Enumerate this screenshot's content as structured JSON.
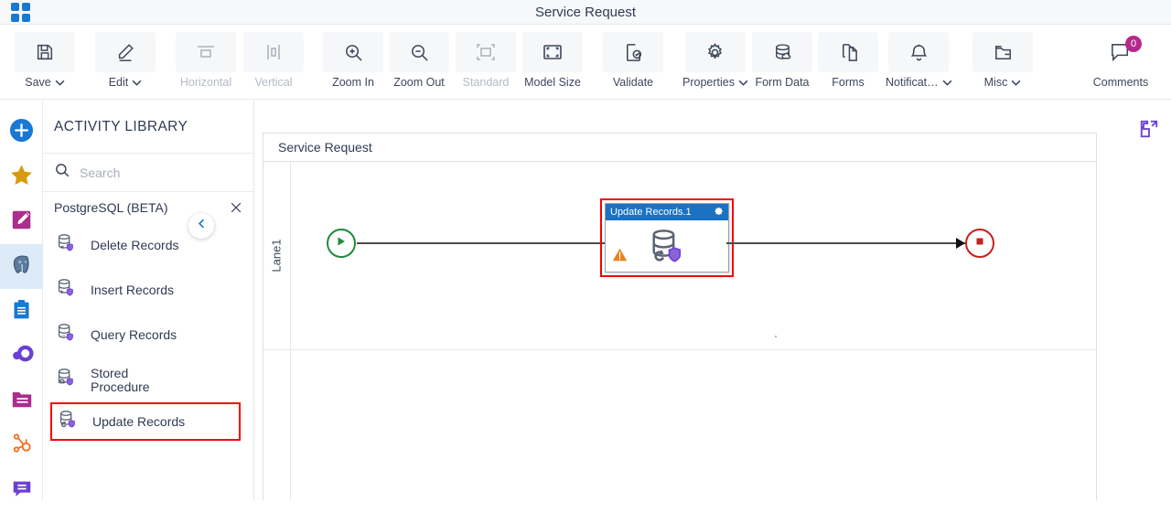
{
  "titlebar": {
    "title": "Service Request",
    "app_menu_icon": "grid-apps-icon"
  },
  "toolbar": {
    "items": [
      {
        "label": "Save",
        "icon": "floppy-disk-icon",
        "dropdown": true,
        "disabled": false
      },
      {
        "label": "Edit",
        "icon": "pencil-icon",
        "dropdown": true,
        "disabled": false
      },
      {
        "label": "Horizontal",
        "icon": "horizontal-align-icon",
        "dropdown": false,
        "disabled": true
      },
      {
        "label": "Vertical",
        "icon": "vertical-align-icon",
        "dropdown": false,
        "disabled": true
      },
      {
        "label": "Zoom In",
        "icon": "zoom-in-icon",
        "dropdown": false,
        "disabled": false
      },
      {
        "label": "Zoom Out",
        "icon": "zoom-out-icon",
        "dropdown": false,
        "disabled": false
      },
      {
        "label": "Standard",
        "icon": "standard-size-icon",
        "dropdown": false,
        "disabled": true
      },
      {
        "label": "Model Size",
        "icon": "model-size-icon",
        "dropdown": false,
        "disabled": false
      },
      {
        "label": "Validate",
        "icon": "validate-doc-icon",
        "dropdown": false,
        "disabled": false
      },
      {
        "label": "Properties",
        "icon": "gear-icon",
        "dropdown": true,
        "disabled": false
      },
      {
        "label": "Form Data",
        "icon": "database-cloud-icon",
        "dropdown": false,
        "disabled": false
      },
      {
        "label": "Forms",
        "icon": "documents-icon",
        "dropdown": false,
        "disabled": false
      },
      {
        "label": "Notificat…",
        "icon": "bell-icon",
        "dropdown": true,
        "disabled": false
      },
      {
        "label": "Misc",
        "icon": "folder-minus-icon",
        "dropdown": true,
        "disabled": false
      }
    ],
    "comments": {
      "label": "Comments",
      "icon": "comment-bubble-icon",
      "badge_count": "0",
      "badge_color": "#b5298b"
    }
  },
  "rail": {
    "items": [
      {
        "name": "add-icon",
        "label": "Add",
        "active": false,
        "color": "#1878d2"
      },
      {
        "name": "star-icon",
        "label": "Favorites",
        "active": false,
        "color": "#d79b10"
      },
      {
        "name": "edit-square-icon",
        "label": "Custom",
        "active": false,
        "color": "#ab2d8e"
      },
      {
        "name": "postgresql-icon",
        "label": "PostgreSQL",
        "active": true,
        "color": "#4a6f96"
      },
      {
        "name": "clipboard-icon",
        "label": "Tasks",
        "active": false,
        "color": "#1878d2"
      },
      {
        "name": "asana-icon",
        "label": "Asana",
        "active": false,
        "color": "#6b3fd4"
      },
      {
        "name": "folder-icon",
        "label": "Folders",
        "active": false,
        "color": "#ab2d8e"
      },
      {
        "name": "hubspot-icon",
        "label": "HubSpot",
        "active": false,
        "color": "#f4701f"
      },
      {
        "name": "chat-icon",
        "label": "Chat",
        "active": false,
        "color": "#6b3fd4"
      }
    ]
  },
  "library": {
    "header": "ACTIVITY LIBRARY",
    "search": {
      "value": "",
      "placeholder": "Search",
      "icon": "search-icon"
    },
    "group": {
      "label": "PostgreSQL (BETA)",
      "close_icon": "close-icon"
    },
    "items": [
      {
        "label": "Delete Records",
        "icon": "db-delete-icon",
        "highlighted": false
      },
      {
        "label": "Insert Records",
        "icon": "db-insert-icon",
        "highlighted": false
      },
      {
        "label": "Query Records",
        "icon": "db-query-icon",
        "highlighted": false
      },
      {
        "label": "Stored Procedure",
        "icon": "db-stored-proc-icon",
        "highlighted": false
      },
      {
        "label": "Update Records",
        "icon": "db-update-icon",
        "highlighted": true
      }
    ],
    "collapse_icon": "chevron-left-icon",
    "highlight_color": "#f60000"
  },
  "canvas": {
    "expand_icon": "expand-fullscreen-icon",
    "pool_title": "Service Request",
    "lanes": [
      {
        "label": "Lane1"
      },
      {
        "label": ""
      }
    ],
    "start_event": {
      "name": "start-event",
      "icon": "play-triangle-icon",
      "color": "#1e8a3c"
    },
    "end_event": {
      "name": "end-event",
      "icon": "stop-square-icon",
      "color": "#c61f1f"
    },
    "task": {
      "title": "Update Records.1",
      "gear_icon": "gear-icon",
      "body_icon": "db-update-icon",
      "warning_icon": "warning-triangle-icon",
      "header_color": "#1a72c4",
      "selection_color": "#f60000"
    }
  }
}
